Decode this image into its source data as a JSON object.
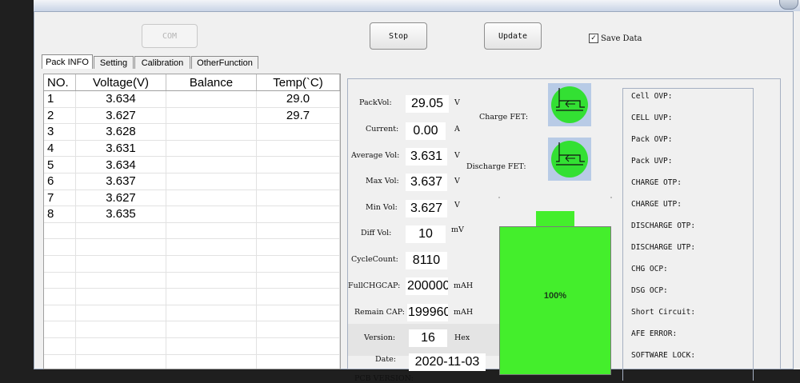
{
  "toolbar": {
    "com_label": "COM",
    "stop_label": "Stop",
    "update_label": "Update",
    "save_data_label": "Save Data",
    "save_data_checked": true
  },
  "tabs": [
    {
      "label": "Pack INFO",
      "active": true
    },
    {
      "label": "Setting",
      "active": false
    },
    {
      "label": "Calibration",
      "active": false
    },
    {
      "label": "OtherFunction",
      "active": false
    }
  ],
  "table": {
    "headers": [
      "NO.",
      "Voltage(V)",
      "Balance",
      "Temp(`C)"
    ],
    "rows": [
      [
        "1",
        "3.634",
        "",
        "29.0"
      ],
      [
        "2",
        "3.627",
        "",
        "29.7"
      ],
      [
        "3",
        "3.628",
        "",
        ""
      ],
      [
        "4",
        "3.631",
        "",
        ""
      ],
      [
        "5",
        "3.634",
        "",
        ""
      ],
      [
        "6",
        "3.637",
        "",
        ""
      ],
      [
        "7",
        "3.627",
        "",
        ""
      ],
      [
        "8",
        "3.635",
        "",
        ""
      ]
    ]
  },
  "pack": {
    "pack_vol": {
      "label": "PackVol:",
      "value": "29.05",
      "unit": "V"
    },
    "current": {
      "label": "Current:",
      "value": "0.00",
      "unit": "A"
    },
    "average_vol": {
      "label": "Average Vol:",
      "value": "3.631",
      "unit": "V"
    },
    "max_vol": {
      "label": "Max Vol:",
      "value": "3.637",
      "unit": "V"
    },
    "min_vol": {
      "label": "Min Vol:",
      "value": "3.627",
      "unit": "V"
    },
    "diff_vol": {
      "label": "Diff Vol:",
      "value": "10",
      "unit": "mV"
    },
    "cycle_count": {
      "label": "CycleCount:",
      "value": "8110"
    },
    "full_chg_cap": {
      "label": "FullCHGCAP:",
      "value": "200000",
      "unit": "mAH"
    },
    "remain_cap": {
      "label": "Remain CAP:",
      "value": "199960",
      "unit": "mAH"
    },
    "version": {
      "label": "Version:",
      "value": "16",
      "unit": "Hex"
    },
    "date": {
      "label": "Date:",
      "value": "2020-11-03"
    },
    "pcb_version": {
      "label": "PCB VERSION:"
    }
  },
  "fets": {
    "charge_label": "Charge FET:",
    "discharge_label": "Discharge FET:",
    "charge_on": true,
    "discharge_on": true,
    "on_color": "#33e033"
  },
  "battery": {
    "level_percent": 100,
    "label": "100%",
    "color": "#44ee2c"
  },
  "alarms": [
    "Cell OVP:",
    "CELL UVP:",
    "Pack OVP:",
    "Pack UVP:",
    "CHARGE OTP:",
    "CHARGE UTP:",
    "DISCHARGE OTP:",
    "DISCHARGE UTP:",
    "CHG OCP:",
    "DSG OCP:",
    "Short Circuit:",
    "AFE ERROR:",
    "SOFTWARE LOCK:"
  ]
}
